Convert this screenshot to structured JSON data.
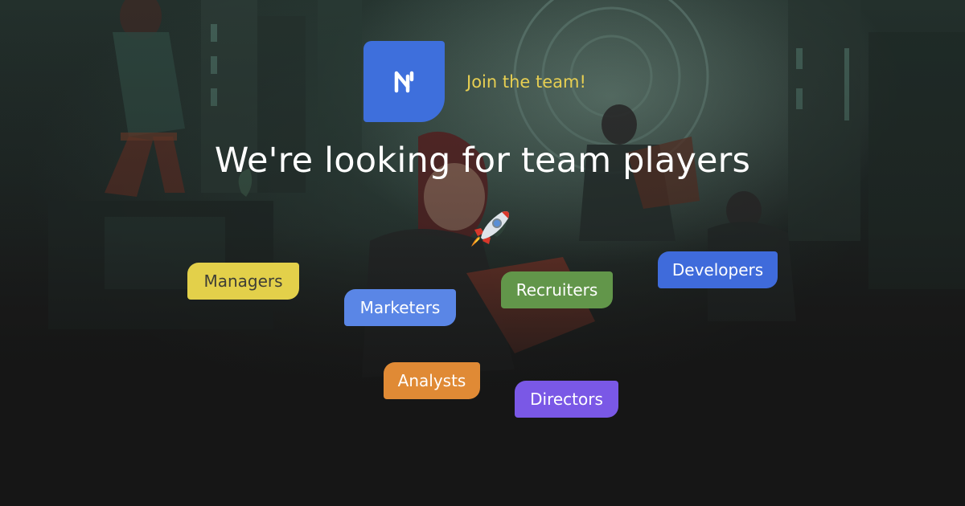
{
  "logo": {
    "letter": "N",
    "color": "#3e6fdc"
  },
  "tagline": "Join the team!",
  "headline": "We're looking for team players",
  "rocket_icon": "rocket-icon",
  "roles": [
    {
      "label": "Managers",
      "color": "#e3d04a"
    },
    {
      "label": "Marketers",
      "color": "#5a86e6"
    },
    {
      "label": "Recruiters",
      "color": "#62964a"
    },
    {
      "label": "Developers",
      "color": "#3f6bdb"
    },
    {
      "label": "Analysts",
      "color": "#e08a35"
    },
    {
      "label": "Directors",
      "color": "#7a58e6"
    }
  ],
  "colors": {
    "tagline": "#e7cf52",
    "background": "#161616"
  }
}
